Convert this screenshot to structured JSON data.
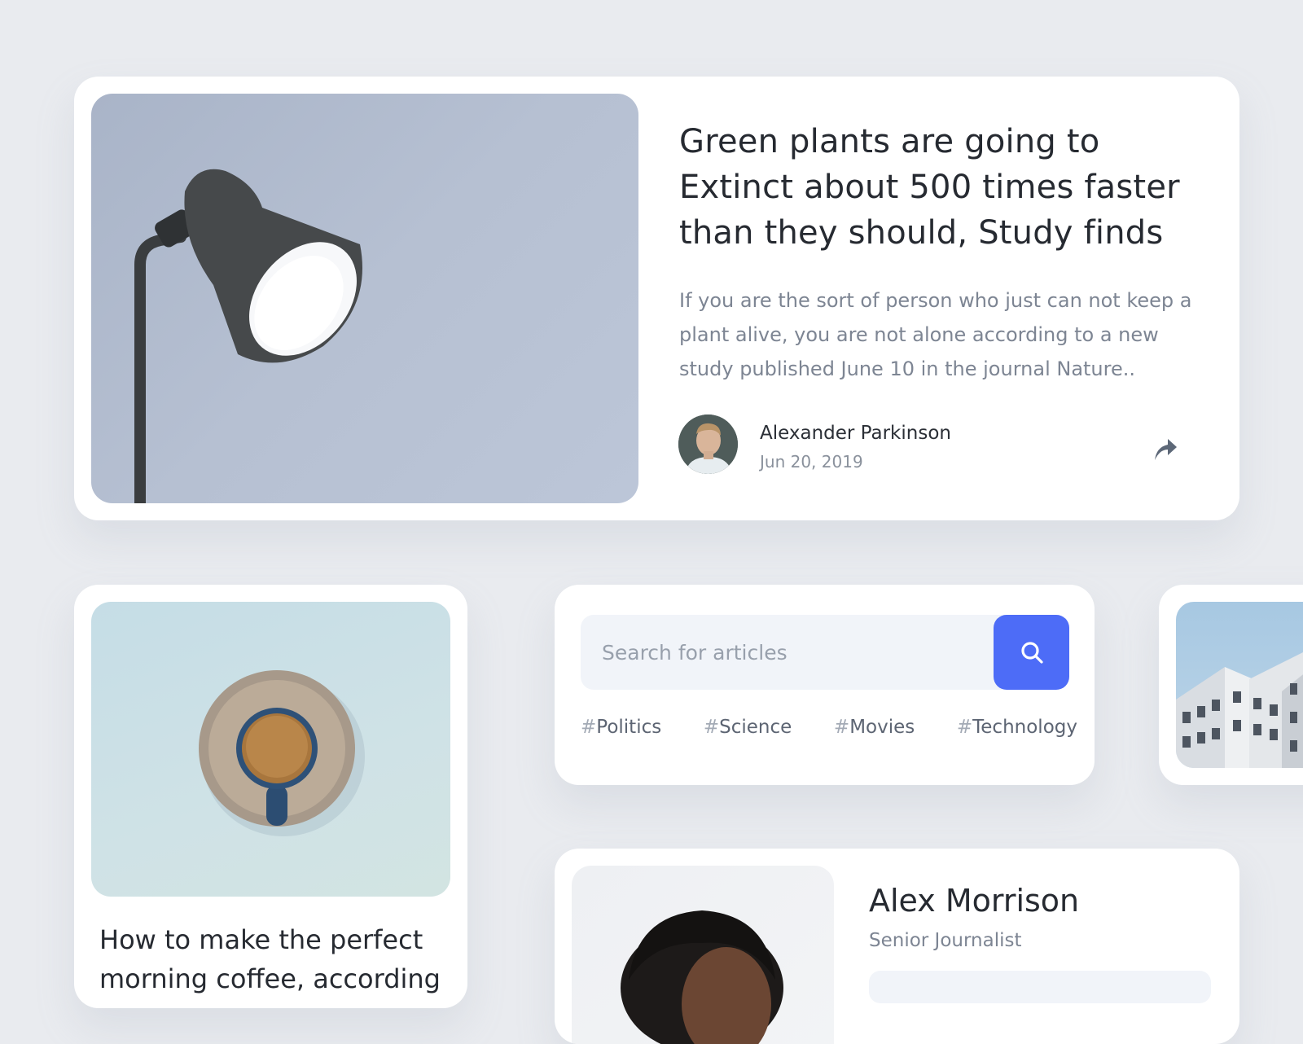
{
  "featured": {
    "title": "Green plants are going to Extinct about 500 times faster than they should, Study finds",
    "excerpt": "If you are the sort of person who just can not keep a plant alive, you are not alone according to a new study published June 10 in the journal Nature..",
    "author": {
      "name": "Alexander Parkinson",
      "date": "Jun 20, 2019"
    },
    "icons": {
      "share": "share-arrow-icon"
    }
  },
  "coffee": {
    "title": "How to make the perfect morning coffee, according"
  },
  "search": {
    "placeholder": "Search for articles",
    "button_icon": "search-icon",
    "accent": "#4d6cf7",
    "tags": [
      {
        "hash": "#",
        "label": "Politics"
      },
      {
        "hash": "#",
        "label": "Science"
      },
      {
        "hash": "#",
        "label": "Movies"
      },
      {
        "hash": "#",
        "label": "Technology"
      }
    ]
  },
  "profile": {
    "name": "Alex Morrison",
    "role": "Senior Journalist"
  }
}
